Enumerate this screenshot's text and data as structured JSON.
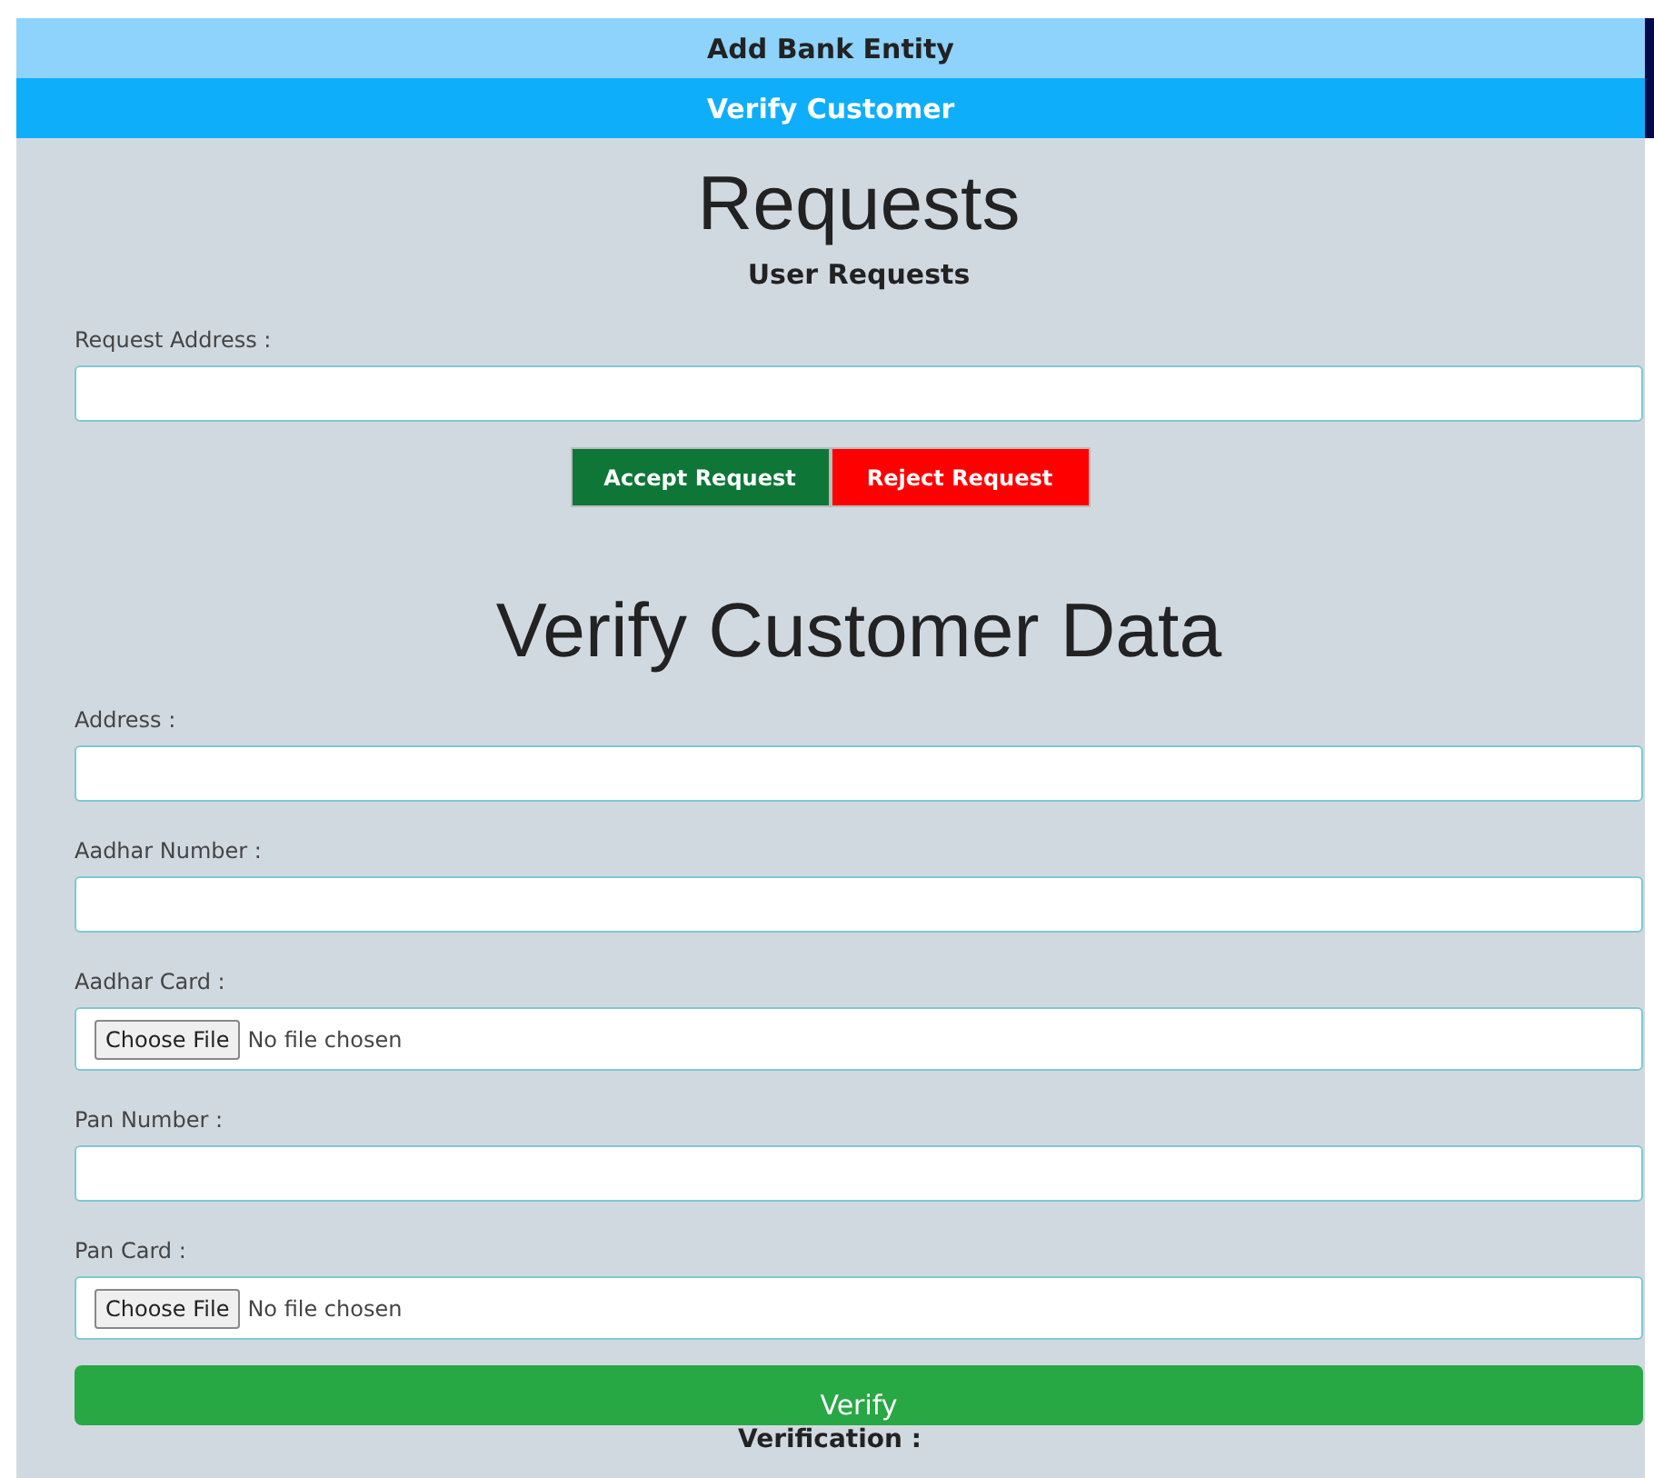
{
  "nav": [
    {
      "label": "Add Bank Entity",
      "selected": false
    },
    {
      "label": "Verify Customer",
      "selected": true
    }
  ],
  "requests": {
    "title": "Requests",
    "subtitle": "User Requests",
    "field": {
      "label": "Request Address :"
    },
    "buttons": [
      {
        "label": "Accept Request",
        "kind": "accept"
      },
      {
        "label": "Reject Request",
        "kind": "reject"
      }
    ]
  },
  "verify": {
    "title": "Verify Customer Data",
    "fields": [
      {
        "label": "Address :",
        "kind": "text"
      },
      {
        "label": "Aadhar Number :",
        "kind": "text"
      },
      {
        "label": "Aadhar Card :",
        "kind": "file",
        "button": "Choose File",
        "status": "No file chosen"
      },
      {
        "label": "Pan Number :",
        "kind": "text"
      },
      {
        "label": "Pan Card :",
        "kind": "file",
        "button": "Choose File",
        "status": "No file chosen"
      }
    ],
    "button": "Verify",
    "result_label": "Verification :"
  }
}
